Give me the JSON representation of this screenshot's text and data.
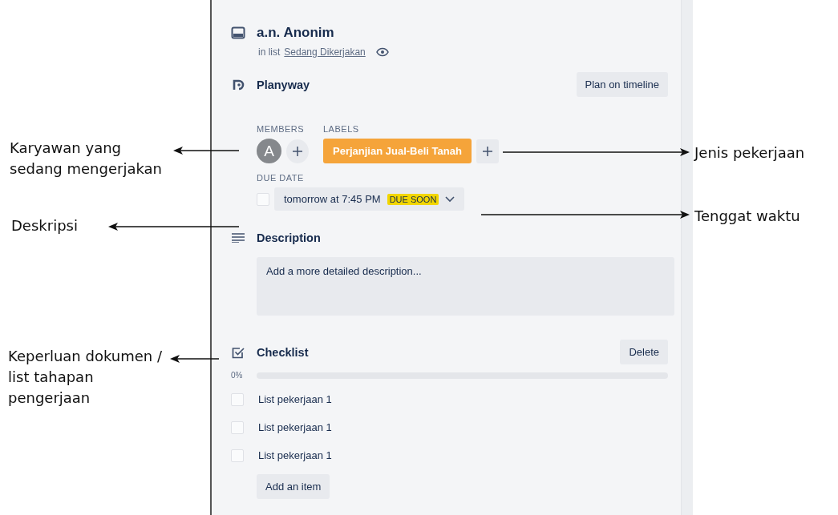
{
  "card": {
    "title": "a.n. Anonim",
    "list_prefix": "in list",
    "list_name": "Sedang Dikerjakan"
  },
  "planyway": {
    "title": "Planyway",
    "button": "Plan on timeline"
  },
  "members": {
    "heading": "MEMBERS",
    "avatar": "A"
  },
  "labels": {
    "heading": "LABELS",
    "items": [
      {
        "text": "Perjanjian Jual-Beli Tanah",
        "color": "#f5a43a"
      }
    ]
  },
  "due_date": {
    "heading": "DUE DATE",
    "checked": false,
    "text": "tomorrow at 7:45 PM",
    "badge": "DUE SOON"
  },
  "description": {
    "title": "Description",
    "placeholder": "Add a more detailed description..."
  },
  "checklist": {
    "title": "Checklist",
    "delete": "Delete",
    "percent": "0%",
    "level": 0,
    "add": "Add an item",
    "items": [
      {
        "text": "List pekerjaan 1",
        "checked": false
      },
      {
        "text": "List pekerjaan 1",
        "checked": false
      },
      {
        "text": "List pekerjaan 1",
        "checked": false
      }
    ]
  },
  "annotations": [
    {
      "text": "Karyawan yang sedang mengerjakan",
      "kind": "left"
    },
    {
      "text": "Deskripsi",
      "kind": "left"
    },
    {
      "text": "Keperluan dokumen / list tahapan pengerjaan",
      "kind": "left"
    },
    {
      "text": "Jenis pekerjaan",
      "kind": "right"
    },
    {
      "text": "Tenggat waktu",
      "kind": "right"
    }
  ]
}
